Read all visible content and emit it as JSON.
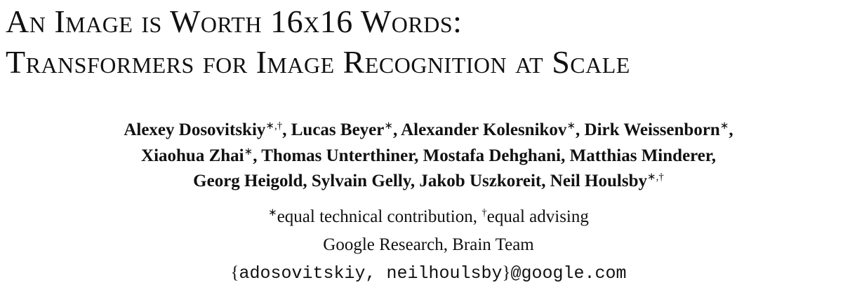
{
  "title": {
    "line1": "An Image is Worth 16x16 Words:",
    "line2": "Transformers for Image Recognition at Scale"
  },
  "authors": {
    "row1": [
      {
        "name": "Alexey Dosovitskiy",
        "mark": "∗,†",
        "sep": ", "
      },
      {
        "name": "Lucas Beyer",
        "mark": "∗",
        "sep": ", "
      },
      {
        "name": "Alexander Kolesnikov",
        "mark": "∗",
        "sep": ", "
      },
      {
        "name": "Dirk Weissenborn",
        "mark": "∗",
        "sep": ","
      }
    ],
    "row2": [
      {
        "name": "Xiaohua Zhai",
        "mark": "∗",
        "sep": ", "
      },
      {
        "name": "Thomas Unterthiner",
        "sep": ", "
      },
      {
        "name": "Mostafa Dehghani",
        "sep": ", "
      },
      {
        "name": "Matthias Minderer",
        "sep": ","
      }
    ],
    "row3": [
      {
        "name": "Georg Heigold",
        "sep": ", "
      },
      {
        "name": "Sylvain Gelly",
        "sep": ", "
      },
      {
        "name": "Jakob Uszkoreit",
        "sep": ", "
      },
      {
        "name": "Neil Houlsby",
        "mark": "∗,†",
        "sep": ""
      }
    ]
  },
  "note": {
    "mark1": "∗",
    "text1": "equal technical contribution, ",
    "mark2": "†",
    "text2": "equal advising"
  },
  "affiliation": "Google Research, Brain Team",
  "email": {
    "open": "{",
    "users": "adosovitskiy, neilhoulsby",
    "close": "}",
    "domain": "@google.com"
  }
}
